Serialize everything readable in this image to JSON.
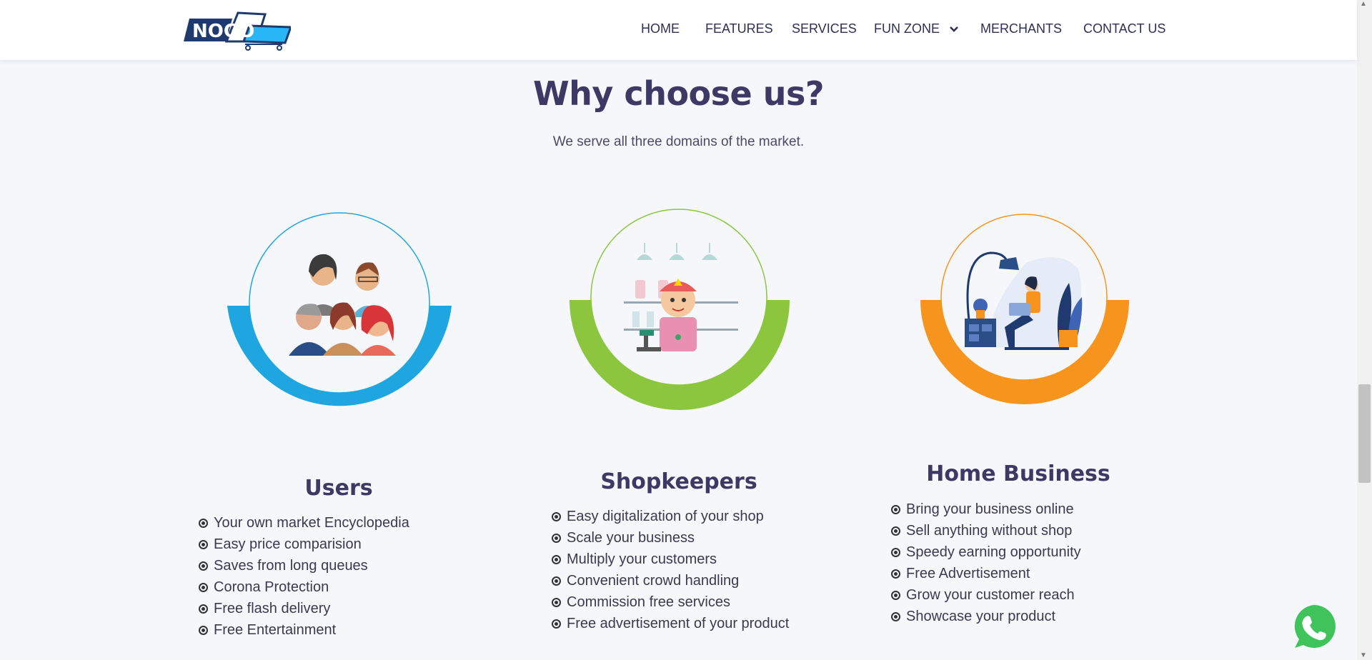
{
  "header": {
    "logo_text": "NOGO",
    "nav": [
      {
        "label": "HOME"
      },
      {
        "label": "FEATURES"
      },
      {
        "label": "SERVICES"
      },
      {
        "label": "FUN ZONE"
      },
      {
        "label": "MERCHANTS"
      },
      {
        "label": "CONTACT US"
      }
    ]
  },
  "section": {
    "title": "Why choose us?",
    "subtitle": "We serve all three domains of the market."
  },
  "cards": [
    {
      "title": "Users",
      "accent": "#1fa6e0",
      "items": [
        "Your own market Encyclopedia",
        "Easy price comparision",
        "Saves from long queues",
        "Corona Protection",
        "Free flash delivery",
        "Free Entertainment"
      ]
    },
    {
      "title": "Shopkeepers",
      "accent": "#8cc63f",
      "items": [
        "Easy digitalization of your shop",
        "Scale your business",
        "Multiply your customers",
        "Convenient crowd handling",
        "Commission free services",
        "Free advertisement of your product"
      ]
    },
    {
      "title": "Home Business",
      "accent": "#f7941d",
      "items": [
        "Bring your business online",
        "Sell anything without shop",
        "Speedy earning opportunity",
        "Free Advertisement",
        "Grow your customer reach",
        "Showcase your product"
      ]
    }
  ],
  "icons": {
    "dropdown": "chevron-down-icon",
    "whatsapp": "whatsapp-phone-icon"
  }
}
